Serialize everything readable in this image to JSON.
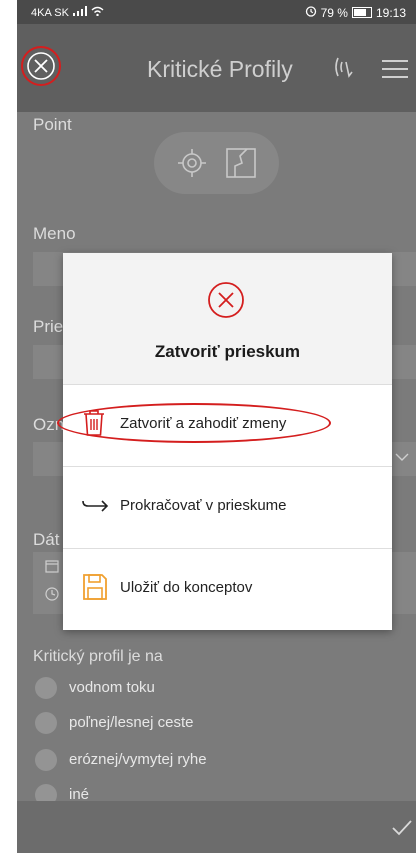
{
  "statusbar": {
    "carrier": "4KA SK",
    "battery": "79 %",
    "time": "19:13"
  },
  "appbar": {
    "title": "Kritické Profily",
    "icons": [
      "close-circle-icon",
      "gps-signal-icon",
      "menu-icon"
    ]
  },
  "form": {
    "point_label": "Point",
    "meno_label": "Meno",
    "prie_label": "Prie",
    "ozn_label": "Ozn",
    "dat_label": "Dát",
    "location_icons": [
      "target-icon",
      "map-icon"
    ],
    "profile_label": "Kritický profil je na",
    "options": [
      "vodnom toku",
      "poľnej/lesnej ceste",
      "eróznej/vymytej ryhe",
      "iné"
    ]
  },
  "dialog": {
    "title": "Zatvoriť prieskum",
    "options": [
      {
        "label": "Zatvoriť a zahodiť zmeny",
        "icon": "trash-icon"
      },
      {
        "label": "Prokračovať v prieskume",
        "icon": "arrow-right-icon"
      },
      {
        "label": "Uložiť do konceptov",
        "icon": "save-icon"
      }
    ]
  },
  "colors": {
    "accent_red": "#d41e1e",
    "save_orange": "#f0a030",
    "appbar": "#5f5f5f",
    "overlay": "#7b7b7b"
  }
}
